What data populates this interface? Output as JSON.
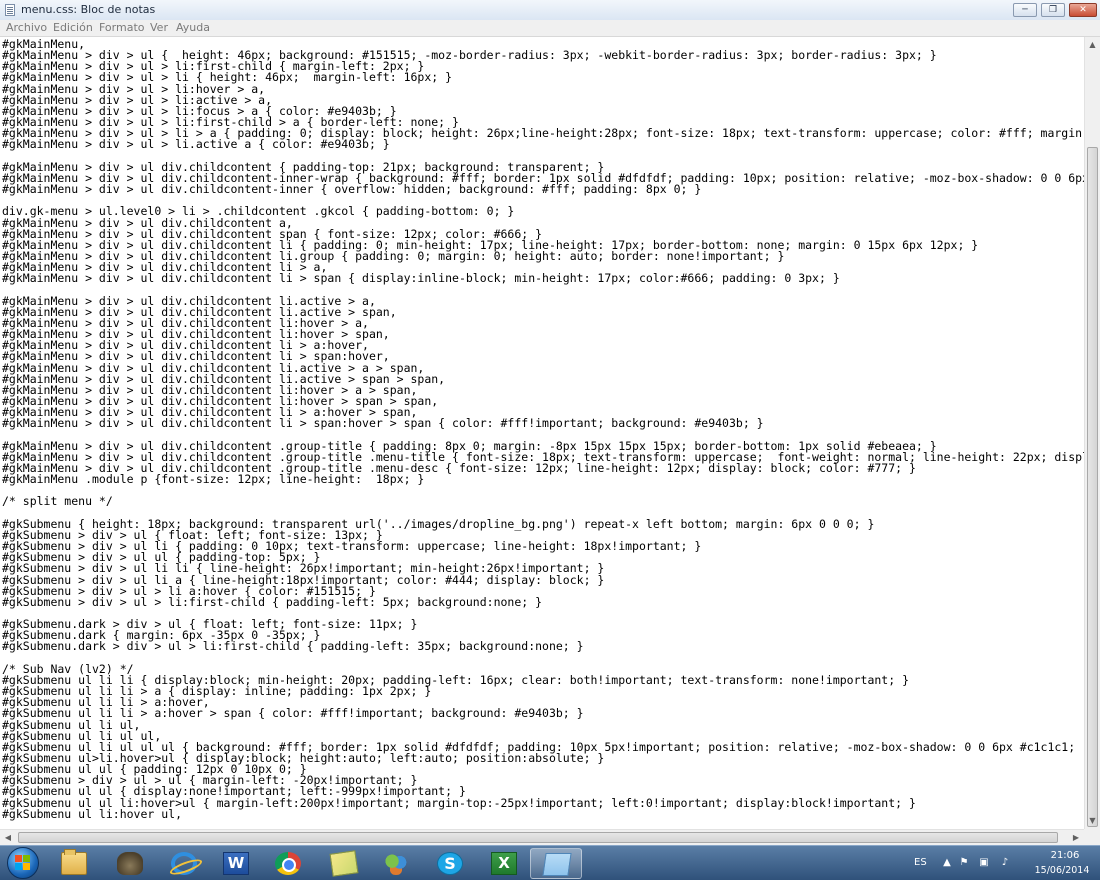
{
  "window": {
    "title": "menu.css: Bloc de notas",
    "controls": {
      "minimize": "─",
      "maximize": "❐",
      "close": "✕"
    }
  },
  "menubar": [
    "Archivo",
    "Edición",
    "Formato",
    "Ver",
    "Ayuda"
  ],
  "editor": {
    "selected_line": 35,
    "lines": [
      "#gkMainMenu,",
      "#gkMainMenu > div > ul {  height: 46px; background: #151515; -moz-border-radius: 3px; -webkit-border-radius: 3px; border-radius: 3px; }",
      "#gkMainMenu > div > ul > li:first-child { margin-left: 2px; }",
      "#gkMainMenu > div > ul > li { height: 46px;  margin-left: 16px; }",
      "#gkMainMenu > div > ul > li:hover > a,",
      "#gkMainMenu > div > ul > li:active > a,",
      "#gkMainMenu > div > ul > li:focus > a { color: #e9403b; }",
      "#gkMainMenu > div > ul > li:first-child > a { border-left: none; }",
      "#gkMainMenu > div > ul > li > a { padding: 0; display: block; height: 26px;line-height:28px; font-size: 18px; text-transform: uppercase; color: #fff; margin:",
      "#gkMainMenu > div > ul > li.active a { color: #e9403b; }",
      "",
      "#gkMainMenu > div > ul div.childcontent { padding-top: 21px; background: transparent; }",
      "#gkMainMenu > div > ul div.childcontent-inner-wrap { background: #fff; border: 1px solid #dfdfdf; padding: 10px; position: relative; -moz-box-shadow: 0 0 6px",
      "#gkMainMenu > div > ul div.childcontent-inner { overflow: hidden; background: #fff; padding: 8px 0; }",
      "",
      "div.gk-menu > ul.level0 > li > .childcontent .gkcol { padding-bottom: 0; }",
      "#gkMainMenu > div > ul div.childcontent a,",
      "#gkMainMenu > div > ul div.childcontent span { font-size: 12px; color: #666; }",
      "#gkMainMenu > div > ul div.childcontent li { padding: 0; min-height: 17px; line-height: 17px; border-bottom: none; margin: 0 15px 6px 12px; }",
      "#gkMainMenu > div > ul div.childcontent li.group { padding: 0; margin: 0; height: auto; border: none!important; }",
      "#gkMainMenu > div > ul div.childcontent li > a,",
      "#gkMainMenu > div > ul div.childcontent li > span { display:inline-block; min-height: 17px; color:#666; padding: 0 3px; }",
      "",
      "#gkMainMenu > div > ul div.childcontent li.active > a,",
      "#gkMainMenu > div > ul div.childcontent li.active > span,",
      "#gkMainMenu > div > ul div.childcontent li:hover > a,",
      "#gkMainMenu > div > ul div.childcontent li:hover > span,",
      "#gkMainMenu > div > ul div.childcontent li > a:hover,",
      "#gkMainMenu > div > ul div.childcontent li > span:hover,",
      "#gkMainMenu > div > ul div.childcontent li.active > a > span,",
      "#gkMainMenu > div > ul div.childcontent li.active > span > span,",
      "#gkMainMenu > div > ul div.childcontent li:hover > a > span,",
      "#gkMainMenu > div > ul div.childcontent li:hover > span > span,",
      "#gkMainMenu > div > ul div.childcontent li > a:hover > span,",
      "#gkMainMenu > div > ul div.childcontent li > span:hover > span { color: #fff!important; background: #e9403b; }",
      "",
      "#gkMainMenu > div > ul div.childcontent .group-title { padding: 8px 0; margin: -8px 15px 15px 15px; border-bottom: 1px solid #ebeaea; }",
      "#gkMainMenu > div > ul div.childcontent .group-title .menu-title { font-size: 18px; text-transform: uppercase;  font-weight: normal; line-height: 22px; displ",
      "#gkMainMenu > div > ul div.childcontent .group-title .menu-desc { font-size: 12px; line-height: 12px; display: block; color: #777; }",
      "#gkMainMenu .module p {font-size: 12px; line-height:  18px; }",
      "",
      "/* split menu */",
      "",
      "#gkSubmenu { height: 18px; background: transparent url('../images/dropline_bg.png') repeat-x left bottom; margin: 6px 0 0 0; }",
      "#gkSubmenu > div > ul { float: left; font-size: 13px; }",
      "#gkSubmenu > div > ul li { padding: 0 10px; text-transform: uppercase; line-height: 18px!important; }",
      "#gkSubmenu > div > ul ul { padding-top: 5px; }",
      "#gkSubmenu > div > ul li li { line-height: 26px!important; min-height:26px!important; }",
      "#gkSubmenu > div > ul li a { line-height:18px!important; color: #444; display: block; }",
      "#gkSubmenu > div > ul > li a:hover { color: #151515; }",
      "#gkSubmenu > div > ul > li:first-child { padding-left: 5px; background:none; }",
      "",
      "#gkSubmenu.dark > div > ul { float: left; font-size: 11px; }",
      "#gkSubmenu.dark { margin: 6px -35px 0 -35px; }",
      "#gkSubmenu.dark > div > ul > li:first-child { padding-left: 35px; background:none; }",
      "",
      "/* Sub Nav (lv2) */",
      "#gkSubmenu ul li li { display:block; min-height: 20px; padding-left: 16px; clear: both!important; text-transform: none!important; }",
      "#gkSubmenu ul li li > a { display: inline; padding: 1px 2px; }",
      "#gkSubmenu ul li li > a:hover,",
      "#gkSubmenu ul li li > a:hover > span { color: #fff!important; background: #e9403b; }",
      "#gkSubmenu ul li ul,",
      "#gkSubmenu ul li ul ul,",
      "#gkSubmenu ul li ul ul ul { background: #fff; border: 1px solid #dfdfdf; padding: 10px 5px!important; position: relative; -moz-box-shadow: 0 0 6px #c1c1c1; -",
      "#gkSubmenu ul>li.hover>ul { display:block; height:auto; left:auto; position:absolute; }",
      "#gkSubmenu ul ul { padding: 12px 0 10px 0; }",
      "#gkSubmenu > div > ul > ul { margin-left: -20px!important; }",
      "#gkSubmenu ul ul { display:none!important; left:-999px!important; }",
      "#gkSubmenu ul ul li:hover>ul { margin-left:200px!important; margin-top:-25px!important; left:0!important; display:block!important; }",
      "#gkSubmenu ul li:hover ul,"
    ]
  },
  "scrollbars": {
    "vertical": {
      "up": "▲",
      "down": "▼"
    },
    "horizontal": {
      "left": "◀",
      "right": "▶"
    }
  },
  "taskbar": {
    "apps": [
      {
        "name": "folder-icon",
        "label": ""
      },
      {
        "name": "gimp-icon",
        "label": ""
      },
      {
        "name": "internet-explorer-icon",
        "label": ""
      },
      {
        "name": "word-icon",
        "label": "W"
      },
      {
        "name": "chrome-icon",
        "label": ""
      },
      {
        "name": "sticky-notes-icon",
        "label": ""
      },
      {
        "name": "people-icon",
        "label": ""
      },
      {
        "name": "skype-icon",
        "label": "S"
      },
      {
        "name": "excel-icon",
        "label": "X"
      },
      {
        "name": "notepad-icon",
        "label": ""
      }
    ],
    "tray": {
      "language": "ES",
      "time": "21:06",
      "date": "15/06/2014"
    }
  }
}
